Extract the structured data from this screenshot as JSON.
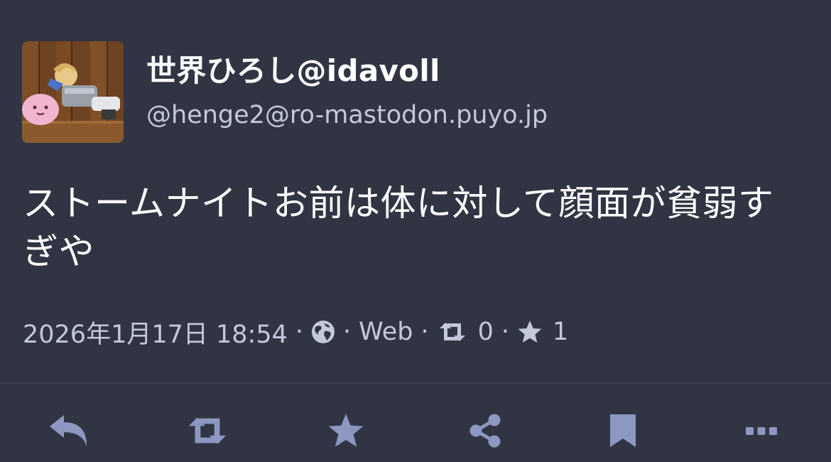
{
  "status": {
    "display_name": "世界ひろし@idavoll",
    "account": "@henge2@ro-mastodon.puyo.jp",
    "content": "ストームナイトお前は体に対して顔面が貧弱すぎや",
    "meta": {
      "timestamp": "2026年1月17日 18:54",
      "separator": "·",
      "visibility_icon": "globe-icon",
      "application": "Web",
      "reblog_icon": "retweet-icon",
      "reblogs_count": "0",
      "favourite_icon": "star-icon",
      "favourites_count": "1"
    }
  },
  "action_bar": {
    "buttons": [
      {
        "name": "reply",
        "icon": "reply-icon"
      },
      {
        "name": "boost",
        "icon": "retweet-icon"
      },
      {
        "name": "favourite",
        "icon": "star-icon"
      },
      {
        "name": "share",
        "icon": "share-icon"
      },
      {
        "name": "bookmark",
        "icon": "bookmark-icon"
      },
      {
        "name": "more",
        "icon": "more-icon"
      }
    ]
  },
  "colors": {
    "background": "#313543",
    "text_primary": "#ffffff",
    "text_secondary": "#c3c8db",
    "action_icon": "#8c98c2",
    "divider": "#3d4253"
  }
}
